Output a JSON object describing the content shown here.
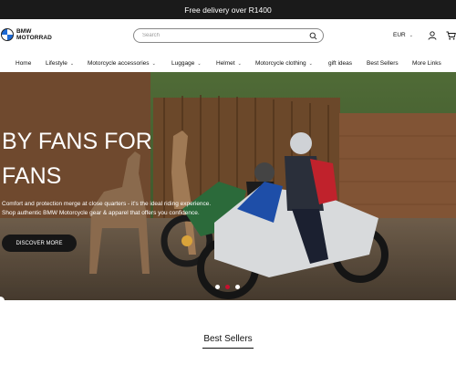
{
  "announcement": {
    "text": "Free delivery over R1400"
  },
  "header": {
    "logo_line1": "BMW",
    "logo_line2": "MOTORRAD",
    "search_placeholder": "Search",
    "currency": "EUR"
  },
  "nav": {
    "items": [
      {
        "label": "Home",
        "dropdown": false
      },
      {
        "label": "Lifestyle",
        "dropdown": true
      },
      {
        "label": "Motorcycle accessories",
        "dropdown": true
      },
      {
        "label": "Luggage",
        "dropdown": true
      },
      {
        "label": "Helmet",
        "dropdown": true
      },
      {
        "label": "Motorcycle clothing",
        "dropdown": true
      },
      {
        "label": "gift ideas",
        "dropdown": false
      },
      {
        "label": "Best Sellers",
        "dropdown": false
      },
      {
        "label": "More Links",
        "dropdown": false
      }
    ]
  },
  "hero": {
    "title_line1": "BY FANS FOR",
    "title_line2": "FANS",
    "desc_line1": "Comfort and protection merge at close quarters - it's the ideal riding experience.",
    "desc_line2": "Shop authentic BMW Motorcycle gear & apparel that offers you confidence.",
    "button_label": "DISCOVER MORE",
    "slide_count": 3,
    "active_slide": 1
  },
  "sections": {
    "best_sellers_heading": "Best Sellers"
  },
  "colors": {
    "announcement_bg": "#1a1a1a",
    "button_bg": "#161616",
    "slide_active": "#c8102e",
    "brand_blue": "#1c69d4"
  }
}
